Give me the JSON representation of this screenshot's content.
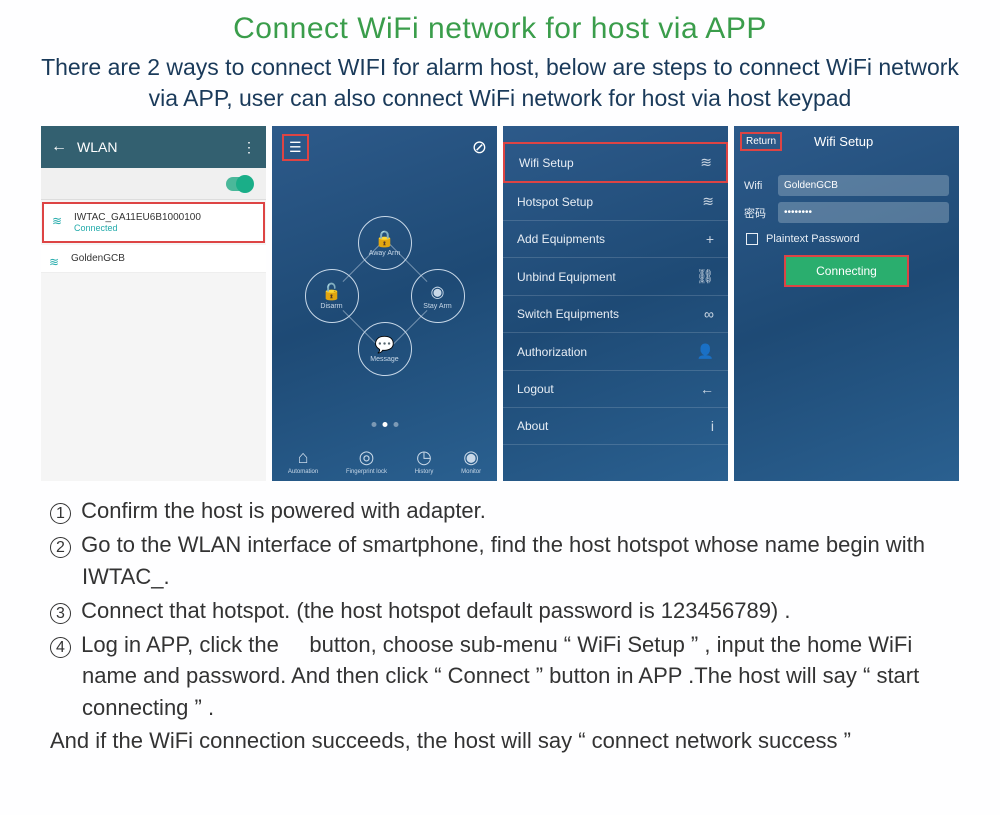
{
  "title": "Connect WiFi network for host via APP",
  "subtitle": "There are 2 ways to connect WIFI for alarm host, below are steps to connect WiFi network via APP, user can also connect WiFi network for host via host keypad",
  "screen1": {
    "header": "WLAN",
    "network1_ssid": "IWTAC_GA11EU6B1000100",
    "network1_status": "Connected",
    "network2_ssid": "GoldenGCB"
  },
  "screen2": {
    "node_top": "Away Arm",
    "node_right": "Stay Arm",
    "node_bottom": "Message",
    "node_left": "Disarm",
    "bottom1": "Automation",
    "bottom2": "Fingerprint lock",
    "bottom3": "History",
    "bottom4": "Monitor"
  },
  "screen3": {
    "r1": "Wifi Setup",
    "r2": "Hotspot Setup",
    "r3": "Add Equipments",
    "r4": "Unbind Equipment",
    "r5": "Switch Equipments",
    "r6": "Authorization",
    "r7": "Logout",
    "r8": "About"
  },
  "screen4": {
    "return": "Return",
    "title": "Wifi Setup",
    "wifi_label": "Wifi",
    "wifi_value": "GoldenGCB",
    "pwd_label": "密码",
    "pwd_value": "••••••••",
    "plaintext": "Plaintext Password",
    "connect": "Connecting"
  },
  "steps": {
    "s1": "Confirm the host is powered with adapter.",
    "s2": "Go to the WLAN interface of smartphone, find the host hotspot whose name begin with IWTAC_.",
    "s3": "Connect that hotspot. (the host hotspot default password is 123456789) .",
    "s4": "Log in APP, click the     button, choose sub-menu “ WiFi Setup ” , input the home WiFi name and password. And then click “ Connect ” button in APP .The host will say “ start connecting ” ."
  },
  "footer": "And if the WiFi connection succeeds, the host will say “ connect network success ”"
}
